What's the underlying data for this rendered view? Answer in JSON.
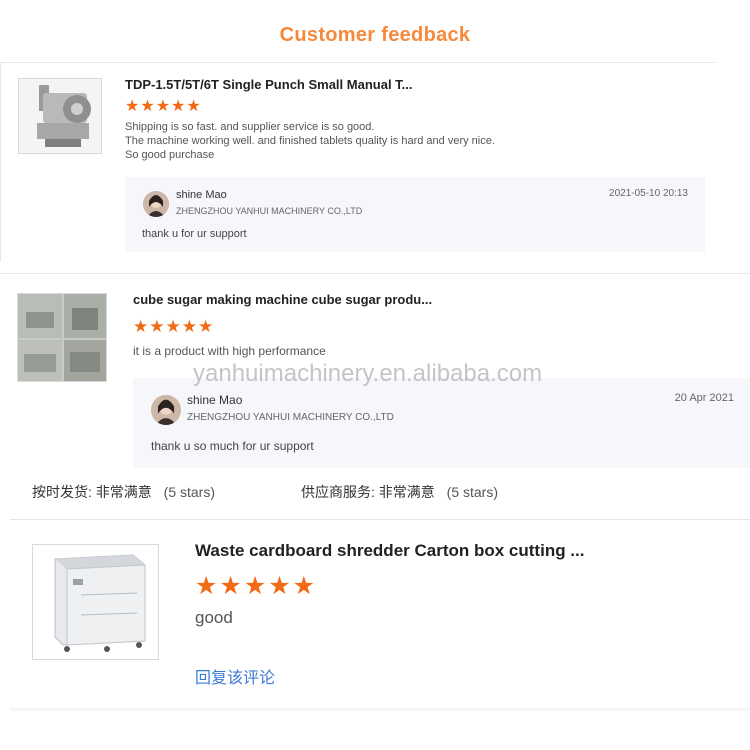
{
  "header": {
    "title": "Customer feedback"
  },
  "reviews": [
    {
      "product_title": "TDP-1.5T/5T/6T Single Punch Small Manual T...",
      "stars": "★★★★★",
      "rating": 5,
      "lines": [
        "Shipping is so fast. and supplier service is so good.",
        "The machine working well. and finished tablets quality is hard and very nice.",
        "So good purchase"
      ],
      "reply": {
        "user": "shine Mao",
        "company": "ZHENGZHOU YANHUI MACHINERY CO.,LTD",
        "date": "2021-05-10 20:13",
        "text": "thank u for ur support"
      }
    },
    {
      "product_title": "cube sugar making machine cube sugar produ...",
      "stars": "★★★★★",
      "rating": 5,
      "text": "it is a product with high performance",
      "reply": {
        "user": "shine Mao",
        "company": "ZHENGZHOU YANHUI MACHINERY CO.,LTD",
        "date": "20 Apr 2021",
        "text": "thank u so much for ur support"
      }
    },
    {
      "product_title": "Waste cardboard shredder Carton box cutting ...",
      "stars": "★★★★★",
      "rating": 5,
      "text": "good",
      "reply_link": "回复该评论"
    }
  ],
  "ratings_row": {
    "delivery_label": "按时发货: 非常满意",
    "delivery_stars": "(5 stars)",
    "service_label": "供应商服务: 非常满意",
    "service_stars": "(5 stars)"
  },
  "watermark": "yanhuimachinery.en.alibaba.com"
}
